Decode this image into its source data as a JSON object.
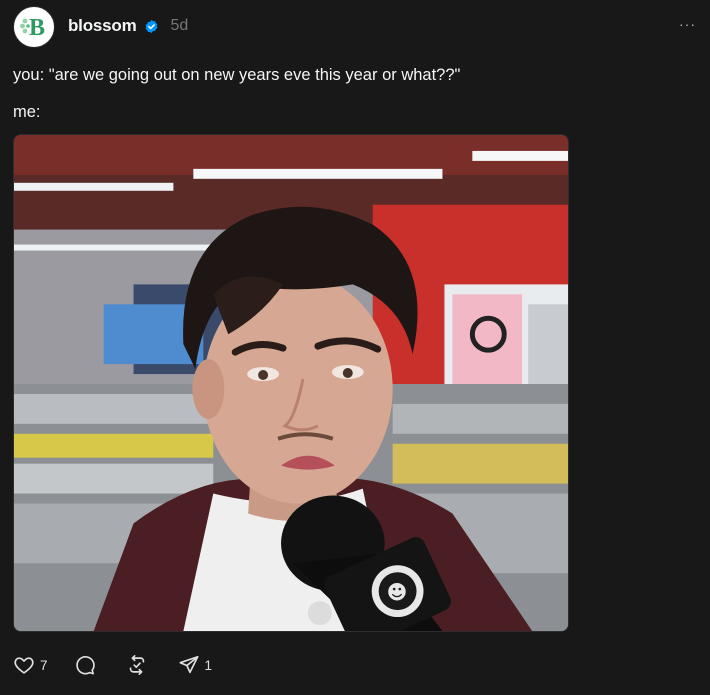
{
  "post": {
    "author": {
      "avatar_letter": "B",
      "username": "blossom",
      "verified_icon": "verified-badge-icon",
      "timestamp": "5d"
    },
    "more_label": "···",
    "lines": [
      "you: \"are we going out on new years eve this year or what??\"",
      "me:"
    ],
    "media": {
      "type": "image",
      "mic_logo_text": "☻"
    },
    "actions": {
      "like_count": "7",
      "reply_count": "",
      "repost_count": "",
      "share_count": "1"
    }
  },
  "colors": {
    "background": "#181818",
    "text": "#f3f5f7",
    "muted": "#777777",
    "verified": "#0095f6",
    "avatar_green": "#2e9a63"
  }
}
